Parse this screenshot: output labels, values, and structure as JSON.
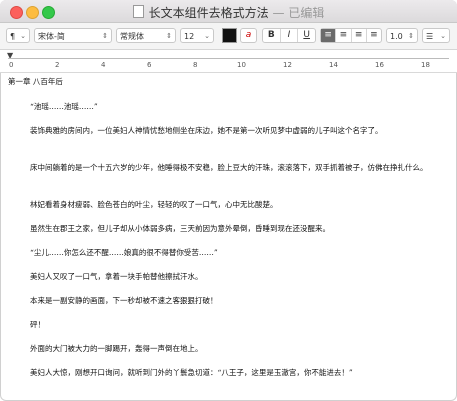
{
  "window": {
    "title": "长文本组件去格式方法",
    "edited": "— 已编辑"
  },
  "toolbar": {
    "paragraph_style": "¶",
    "font_family": "宋体-简",
    "font_style": "常规体",
    "font_size": "12",
    "bold": "B",
    "italic": "I",
    "underline": "U",
    "line_spacing": "1.0",
    "list_style": "☰",
    "text_color": "#111111"
  },
  "ruler": {
    "labels": [
      "0",
      "2",
      "4",
      "6",
      "8",
      "10",
      "12",
      "14",
      "16",
      "18"
    ]
  },
  "document": {
    "paragraphs": [
      "第一章 八百年后",
      "“池瑶……池瑶……”",
      "装饰典雅的房间内，一位美妇人神情忧愁地侧坐在床边，她不是第一次听见梦中虚弱的儿子叫这个名字了。",
      "床中间躺着的是一个十五六岁的少年，他睡得极不安稳，脸上豆大的汗珠，滚滚落下，双手抓着被子，仿佛在挣扎什么。",
      "林妃看着身材瘦弱、脸色苍白的叶尘，轻轻的叹了一口气，心中无比酸楚。",
      "虽然生在郡王之家，但儿子却从小体弱多病，三天前因为意外晕倒，昏睡到现在还没醒来。",
      "“尘儿……你怎么还不醒……娘真的很不得替你受苦……”",
      "美妇人又叹了一口气，拿着一块手帕替他擦拭汗水。",
      "本来是一副安静的画面，下一秒却被不速之客狠狠打破！",
      "砰！",
      "外面的大门被大力的一脚踢开，轰得一声倒在地上。",
      "美妇人大惊，刚想开口询问，就听到门外的丫鬟急切道：“八王子，这里是玉澈宫，你不能进去！”"
    ]
  }
}
